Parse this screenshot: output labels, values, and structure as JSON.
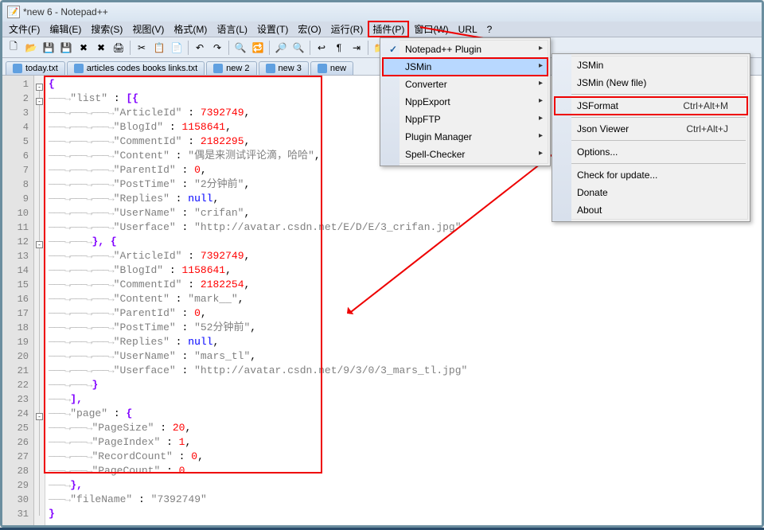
{
  "window": {
    "title": "*new  6 - Notepad++"
  },
  "menubar": [
    {
      "label": "文件(F)"
    },
    {
      "label": "编辑(E)"
    },
    {
      "label": "搜索(S)"
    },
    {
      "label": "视图(V)"
    },
    {
      "label": "格式(M)"
    },
    {
      "label": "语言(L)"
    },
    {
      "label": "设置(T)"
    },
    {
      "label": "宏(O)"
    },
    {
      "label": "运行(R)"
    },
    {
      "label": "插件(P)",
      "highlighted": true
    },
    {
      "label": "窗口(W)"
    },
    {
      "label": "URL"
    },
    {
      "label": "?"
    }
  ],
  "tabs": [
    {
      "label": "today.txt"
    },
    {
      "label": "articles codes books links.txt"
    },
    {
      "label": "new  2"
    },
    {
      "label": "new  3"
    },
    {
      "label": "new"
    }
  ],
  "code_lines": [
    {
      "n": 1,
      "segs": [
        {
          "t": "{",
          "c": "brace"
        }
      ]
    },
    {
      "n": 2,
      "indent": 1,
      "segs": [
        {
          "t": "\"list\"",
          "c": "str"
        },
        {
          "t": " : "
        },
        {
          "t": "[{",
          "c": "brace"
        }
      ]
    },
    {
      "n": 3,
      "indent": 3,
      "segs": [
        {
          "t": "\"ArticleId\"",
          "c": "str"
        },
        {
          "t": " : "
        },
        {
          "t": "7392749",
          "c": "num"
        },
        {
          "t": ","
        }
      ]
    },
    {
      "n": 4,
      "indent": 3,
      "segs": [
        {
          "t": "\"BlogId\"",
          "c": "str"
        },
        {
          "t": " : "
        },
        {
          "t": "1158641",
          "c": "num"
        },
        {
          "t": ","
        }
      ]
    },
    {
      "n": 5,
      "indent": 3,
      "segs": [
        {
          "t": "\"CommentId\"",
          "c": "str"
        },
        {
          "t": " : "
        },
        {
          "t": "2182295",
          "c": "num"
        },
        {
          "t": ","
        }
      ]
    },
    {
      "n": 6,
      "indent": 3,
      "segs": [
        {
          "t": "\"Content\"",
          "c": "str"
        },
        {
          "t": " : "
        },
        {
          "t": "\"偶是来测试评论滴，哈哈\"",
          "c": "str"
        },
        {
          "t": ","
        }
      ]
    },
    {
      "n": 7,
      "indent": 3,
      "segs": [
        {
          "t": "\"ParentId\"",
          "c": "str"
        },
        {
          "t": " : "
        },
        {
          "t": "0",
          "c": "num"
        },
        {
          "t": ","
        }
      ]
    },
    {
      "n": 8,
      "indent": 3,
      "segs": [
        {
          "t": "\"PostTime\"",
          "c": "str"
        },
        {
          "t": " : "
        },
        {
          "t": "\"2分钟前\"",
          "c": "str"
        },
        {
          "t": ","
        }
      ]
    },
    {
      "n": 9,
      "indent": 3,
      "segs": [
        {
          "t": "\"Replies\"",
          "c": "str"
        },
        {
          "t": " : "
        },
        {
          "t": "null",
          "c": "kw"
        },
        {
          "t": ","
        }
      ]
    },
    {
      "n": 10,
      "indent": 3,
      "segs": [
        {
          "t": "\"UserName\"",
          "c": "str"
        },
        {
          "t": " : "
        },
        {
          "t": "\"crifan\"",
          "c": "str"
        },
        {
          "t": ","
        }
      ]
    },
    {
      "n": 11,
      "indent": 3,
      "segs": [
        {
          "t": "\"Userface\"",
          "c": "str"
        },
        {
          "t": " : "
        },
        {
          "t": "\"http://avatar.csdn.net/E/D/E/3_crifan.jpg\"",
          "c": "str"
        }
      ]
    },
    {
      "n": 12,
      "indent": 2,
      "segs": [
        {
          "t": "}, {",
          "c": "brace"
        }
      ]
    },
    {
      "n": 13,
      "indent": 3,
      "segs": [
        {
          "t": "\"ArticleId\"",
          "c": "str"
        },
        {
          "t": " : "
        },
        {
          "t": "7392749",
          "c": "num"
        },
        {
          "t": ","
        }
      ]
    },
    {
      "n": 14,
      "indent": 3,
      "segs": [
        {
          "t": "\"BlogId\"",
          "c": "str"
        },
        {
          "t": " : "
        },
        {
          "t": "1158641",
          "c": "num"
        },
        {
          "t": ","
        }
      ]
    },
    {
      "n": 15,
      "indent": 3,
      "segs": [
        {
          "t": "\"CommentId\"",
          "c": "str"
        },
        {
          "t": " : "
        },
        {
          "t": "2182254",
          "c": "num"
        },
        {
          "t": ","
        }
      ]
    },
    {
      "n": 16,
      "indent": 3,
      "segs": [
        {
          "t": "\"Content\"",
          "c": "str"
        },
        {
          "t": " : "
        },
        {
          "t": "\"mark__\"",
          "c": "str"
        },
        {
          "t": ","
        }
      ]
    },
    {
      "n": 17,
      "indent": 3,
      "segs": [
        {
          "t": "\"ParentId\"",
          "c": "str"
        },
        {
          "t": " : "
        },
        {
          "t": "0",
          "c": "num"
        },
        {
          "t": ","
        }
      ]
    },
    {
      "n": 18,
      "indent": 3,
      "segs": [
        {
          "t": "\"PostTime\"",
          "c": "str"
        },
        {
          "t": " : "
        },
        {
          "t": "\"52分钟前\"",
          "c": "str"
        },
        {
          "t": ","
        }
      ]
    },
    {
      "n": 19,
      "indent": 3,
      "segs": [
        {
          "t": "\"Replies\"",
          "c": "str"
        },
        {
          "t": " : "
        },
        {
          "t": "null",
          "c": "kw"
        },
        {
          "t": ","
        }
      ]
    },
    {
      "n": 20,
      "indent": 3,
      "segs": [
        {
          "t": "\"UserName\"",
          "c": "str"
        },
        {
          "t": " : "
        },
        {
          "t": "\"mars_tl\"",
          "c": "str"
        },
        {
          "t": ","
        }
      ]
    },
    {
      "n": 21,
      "indent": 3,
      "segs": [
        {
          "t": "\"Userface\"",
          "c": "str"
        },
        {
          "t": " : "
        },
        {
          "t": "\"http://avatar.csdn.net/9/3/0/3_mars_tl.jpg\"",
          "c": "str"
        }
      ]
    },
    {
      "n": 22,
      "indent": 2,
      "segs": [
        {
          "t": "}",
          "c": "brace"
        }
      ]
    },
    {
      "n": 23,
      "indent": 1,
      "segs": [
        {
          "t": "],",
          "c": "brace"
        }
      ]
    },
    {
      "n": 24,
      "indent": 1,
      "segs": [
        {
          "t": "\"page\"",
          "c": "str"
        },
        {
          "t": " : "
        },
        {
          "t": "{",
          "c": "brace"
        }
      ]
    },
    {
      "n": 25,
      "indent": 2,
      "segs": [
        {
          "t": "\"PageSize\"",
          "c": "str"
        },
        {
          "t": " : "
        },
        {
          "t": "20",
          "c": "num"
        },
        {
          "t": ","
        }
      ]
    },
    {
      "n": 26,
      "indent": 2,
      "segs": [
        {
          "t": "\"PageIndex\"",
          "c": "str"
        },
        {
          "t": " : "
        },
        {
          "t": "1",
          "c": "num"
        },
        {
          "t": ","
        }
      ]
    },
    {
      "n": 27,
      "indent": 2,
      "segs": [
        {
          "t": "\"RecordCount\"",
          "c": "str"
        },
        {
          "t": " : "
        },
        {
          "t": "0",
          "c": "num"
        },
        {
          "t": ","
        }
      ]
    },
    {
      "n": 28,
      "indent": 2,
      "segs": [
        {
          "t": "\"PageCount\"",
          "c": "str"
        },
        {
          "t": " : "
        },
        {
          "t": "0",
          "c": "num"
        }
      ]
    },
    {
      "n": 29,
      "indent": 1,
      "segs": [
        {
          "t": "},",
          "c": "brace"
        }
      ]
    },
    {
      "n": 30,
      "indent": 1,
      "segs": [
        {
          "t": "\"fileName\"",
          "c": "str"
        },
        {
          "t": " : "
        },
        {
          "t": "\"7392749\"",
          "c": "str"
        }
      ]
    },
    {
      "n": 31,
      "segs": [
        {
          "t": "}",
          "c": "brace"
        }
      ]
    }
  ],
  "plugins_menu": {
    "items": [
      {
        "label": "Notepad++ Plugin",
        "sub": true,
        "checked": true
      },
      {
        "label": "JSMin",
        "sub": true,
        "highlighted": true,
        "selected": true
      },
      {
        "label": "Converter",
        "sub": true
      },
      {
        "label": "NppExport",
        "sub": true
      },
      {
        "label": "NppFTP",
        "sub": true
      },
      {
        "label": "Plugin Manager",
        "sub": true
      },
      {
        "label": "Spell-Checker",
        "sub": true
      }
    ]
  },
  "jsmin_submenu": {
    "items": [
      {
        "label": "JSMin"
      },
      {
        "label": "JSMin (New file)"
      },
      {
        "sep": true
      },
      {
        "label": "JSFormat",
        "shortcut": "Ctrl+Alt+M",
        "highlighted": true
      },
      {
        "sep": true
      },
      {
        "label": "Json Viewer",
        "shortcut": "Ctrl+Alt+J"
      },
      {
        "sep": true
      },
      {
        "label": "Options..."
      },
      {
        "sep": true
      },
      {
        "label": "Check for update..."
      },
      {
        "label": "Donate"
      },
      {
        "label": "About"
      }
    ]
  }
}
